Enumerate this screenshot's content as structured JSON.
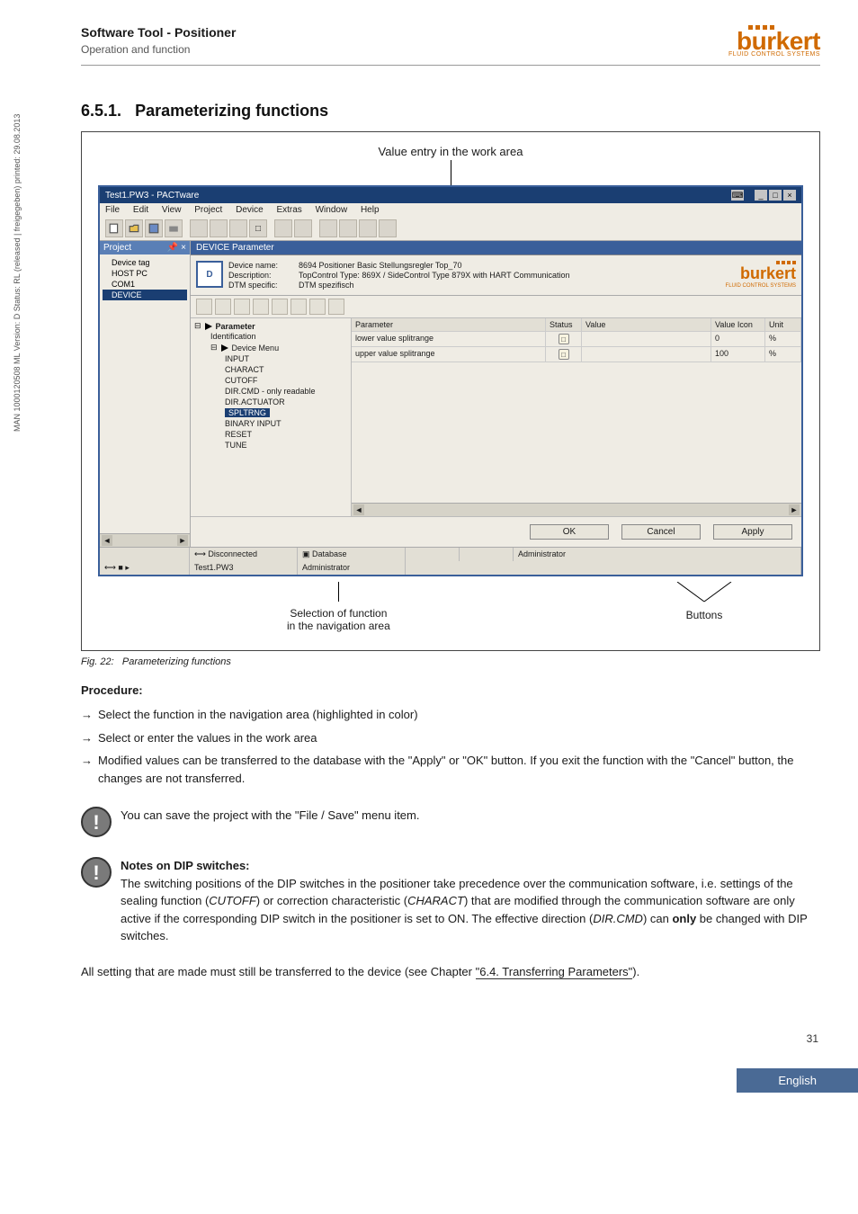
{
  "vertical_note": "MAN 1000120508 ML Version: D Status: RL (released | freigegeben) printed: 29.08.2013",
  "header": {
    "title": "Software Tool - Positioner",
    "sub": "Operation and function",
    "logo_text": "burkert",
    "logo_sub": "FLUID CONTROL SYSTEMS"
  },
  "section": {
    "num": "6.5.1.",
    "title": "Parameterizing functions"
  },
  "figure": {
    "top_label": "Value entry in the work area",
    "bottom_left_l1": "Selection of function",
    "bottom_left_l2": "in the navigation area",
    "bottom_right": "Buttons",
    "caption_prefix": "Fig. 22:",
    "caption_text": "Parameterizing functions"
  },
  "screenshot": {
    "window_title": "Test1.PW3 - PACTware",
    "menubar": [
      "File",
      "Edit",
      "View",
      "Project",
      "Device",
      "Extras",
      "Window",
      "Help"
    ],
    "side": {
      "header": "Project",
      "items": [
        "Device tag",
        "HOST PC",
        "COM1",
        "DEVICE"
      ],
      "selected_index": 3
    },
    "tab_label": "DEVICE Parameter",
    "device_head": {
      "rows": [
        [
          "Device name:",
          "8694 Positioner Basic Stellungsregler Top_70"
        ],
        [
          "Description:",
          "TopControl Type: 869X / SideControl Type 879X  with HART Communication"
        ],
        [
          "DTM specific:",
          "DTM spezifisch"
        ]
      ],
      "logo_text": "burkert",
      "logo_sub": "FLUID CONTROL SYSTEMS"
    },
    "nav": {
      "root": "Parameter",
      "identification": "Identification",
      "device_menu": "Device Menu",
      "children": [
        "INPUT",
        "CHARACT",
        "CUTOFF",
        "DIR.CMD - only readable",
        "DIR.ACTUATOR",
        "SPLTRNG",
        "BINARY INPUT",
        "RESET",
        "TUNE"
      ],
      "selected": "SPLTRNG"
    },
    "table": {
      "headers": [
        "Parameter",
        "Status",
        "Value",
        "Value Icon",
        "Unit"
      ],
      "rows": [
        {
          "param": "lower value splitrange",
          "value": "0",
          "unit": "%"
        },
        {
          "param": "upper value splitrange",
          "value": "100",
          "unit": "%"
        }
      ]
    },
    "buttons": {
      "ok": "OK",
      "cancel": "Cancel",
      "apply": "Apply"
    },
    "statusbar": {
      "disconnected": "Disconnected",
      "database": "Database",
      "admin": "Administrator",
      "project": "Test1.PW3",
      "admin2": "Administrator"
    }
  },
  "procedure": {
    "heading": "Procedure:",
    "items": [
      "Select the function in the navigation area (highlighted in color)",
      "Select or enter the values in the work area",
      "Modified values can be transferred to the database with the \"Apply\" or \"OK\" button. If you exit the function with the \"Cancel\" button, the changes are not transferred."
    ]
  },
  "note_save": "You can save the project with the \"File / Save\" menu item.",
  "dip": {
    "heading": "Notes on DIP switches:",
    "text_1": "The switching positions of the DIP switches in the positioner take precedence over the communication software, i.e. settings of the sealing function (",
    "i1": "CUTOFF",
    "text_2": ") or correction characteristic (",
    "i2": "CHARACT",
    "text_3": ") that are modified through the communication software are only active if the corresponding DIP switch in the positioner is set to ON. The effective direction (",
    "i3": "DIR.CMD",
    "text_4": ") can ",
    "b1": "only",
    "text_5": " be changed with DIP switches."
  },
  "lastline": {
    "pre": "All setting that are made must still be transferred to the device (see Chapter ",
    "link": "\"6.4. Transferring Parameters\"",
    "post": ")."
  },
  "page_number": "31",
  "language": "English"
}
